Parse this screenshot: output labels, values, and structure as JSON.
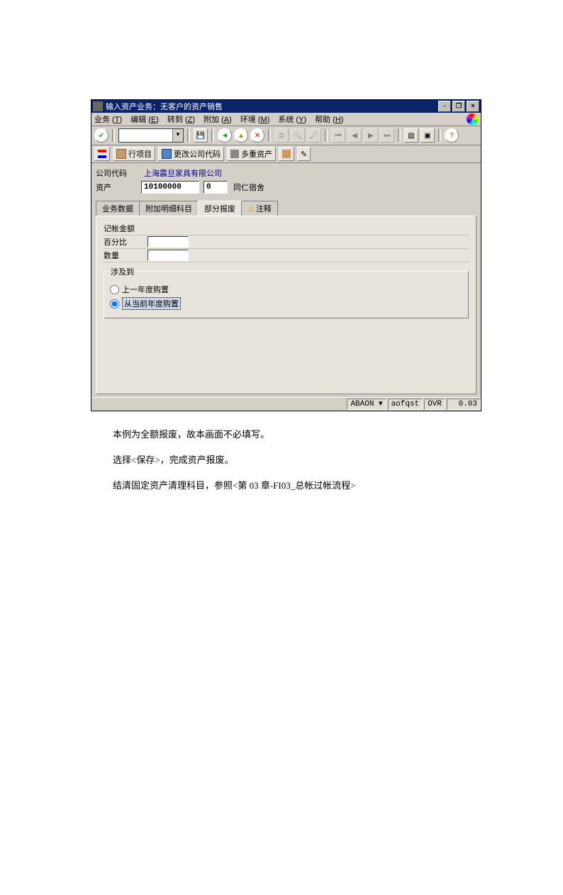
{
  "window": {
    "title": "输入资产业务：无客户的资产销售",
    "controls": {
      "min": "-",
      "restore": "❐",
      "close": "×"
    }
  },
  "menu": {
    "items": [
      {
        "label": "业务",
        "key": "T"
      },
      {
        "label": "编辑",
        "key": "E"
      },
      {
        "label": "转到",
        "key": "Z"
      },
      {
        "label": "附加",
        "key": "A"
      },
      {
        "label": "环境",
        "key": "M"
      },
      {
        "label": "系统",
        "key": "Y"
      },
      {
        "label": "帮助",
        "key": "H"
      }
    ]
  },
  "toolbar2": [
    {
      "label": "",
      "icon": "ico-flag"
    },
    {
      "label": "行项目",
      "icon": "ico-cube"
    },
    {
      "label": "更改公司代码",
      "icon": "ico-grid"
    },
    {
      "label": "多重资产",
      "icon": "ico-multi"
    },
    {
      "label": "",
      "icon": "ico-book"
    },
    {
      "label": "",
      "icon": ""
    }
  ],
  "header": {
    "company_code_label": "公司代码",
    "company_name": "上海震旦家具有限公司",
    "asset_label": "资产",
    "asset_no": "10100000",
    "asset_sub": "0",
    "asset_desc": "同仁宿舍"
  },
  "tabs": [
    {
      "label": "业务数据",
      "active": false
    },
    {
      "label": "附加明细科目",
      "active": false
    },
    {
      "label": "部分报废",
      "active": true
    },
    {
      "label": "注释",
      "active": false,
      "tick": true
    }
  ],
  "fields": {
    "posting_amount": "记帐金额",
    "percent": "百分比",
    "qty": "数量"
  },
  "group": {
    "title": "涉及到",
    "opt1": "上一年度购置",
    "opt2": "从当前年度购置"
  },
  "status": {
    "tcode": "ABAON",
    "sys": "aofqst",
    "ovr": "OVR",
    "time": "0.03"
  },
  "doc": {
    "p1": "本例为全额报废，故本画面不必填写。",
    "p2": "选择<保存>，完成资产报废。",
    "p3": "结清固定资产清理科目，参照<第 03 章-FI03_总帐过帐流程>"
  }
}
